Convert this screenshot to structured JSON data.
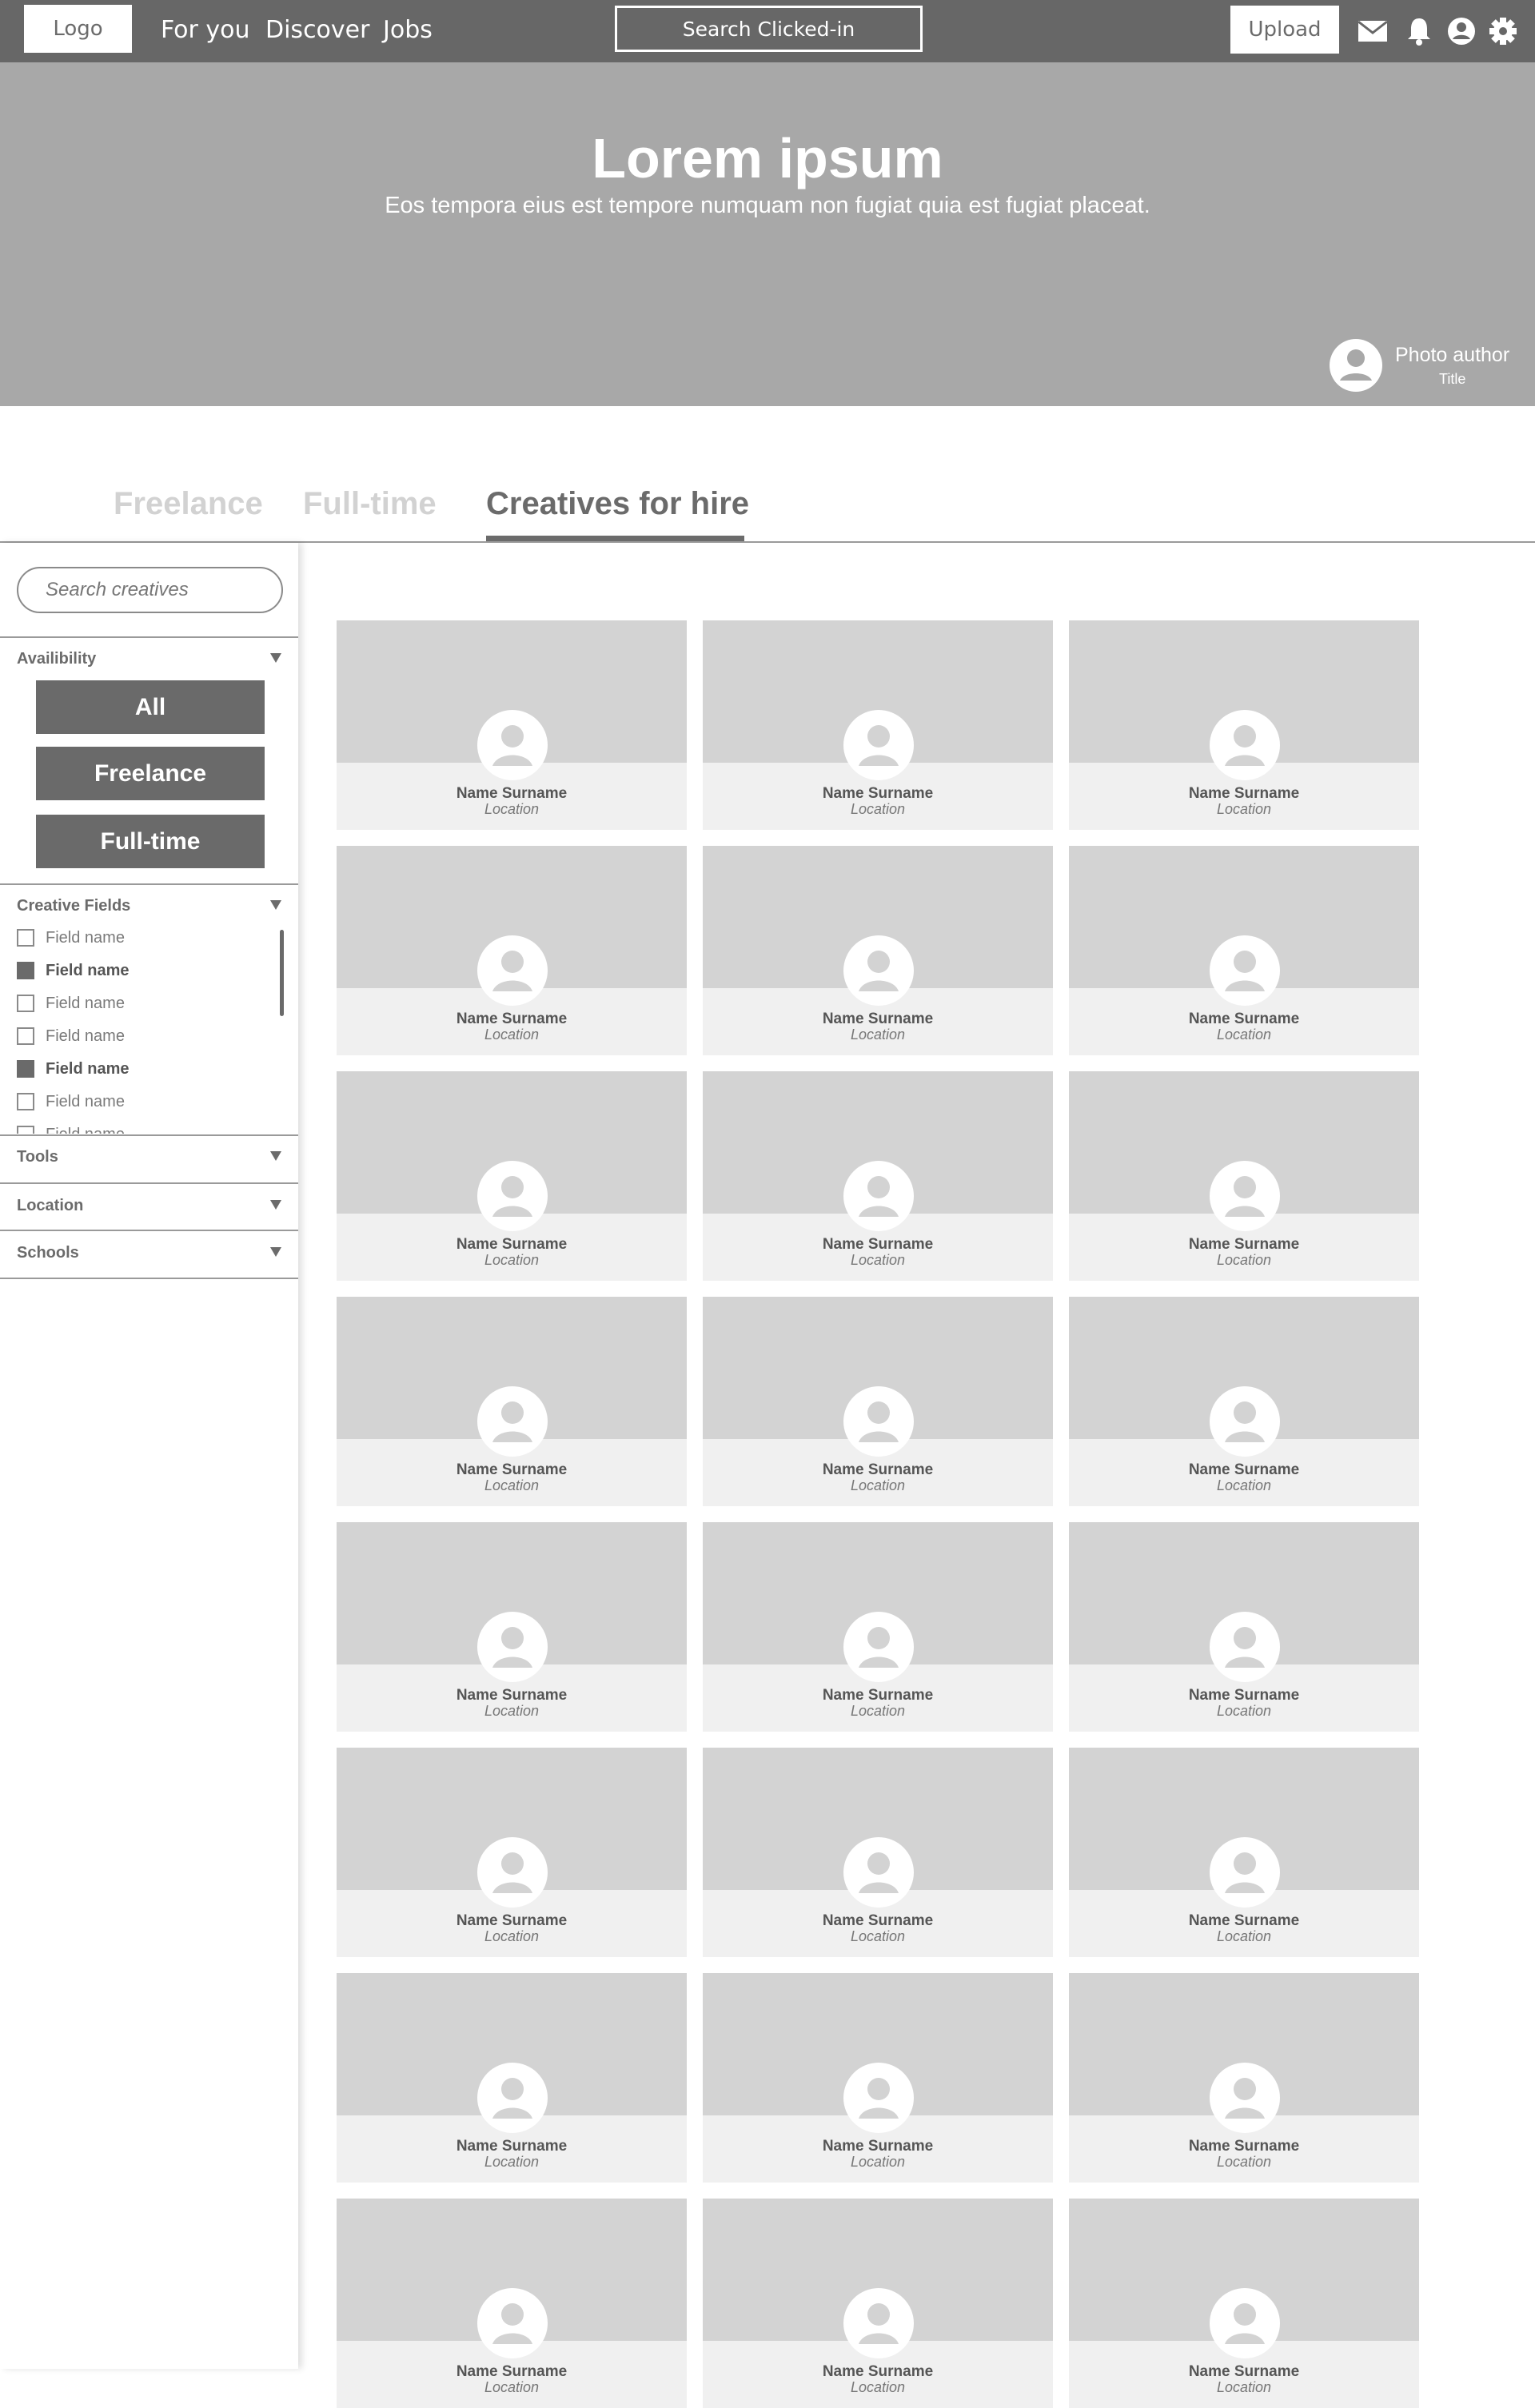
{
  "header": {
    "logo": "Logo",
    "nav": [
      "For you",
      "Discover",
      "Jobs"
    ],
    "search_label": "Search Clicked-in",
    "upload_label": "Upload",
    "icons": [
      "mail-icon",
      "bell-icon",
      "user-icon",
      "gear-icon"
    ]
  },
  "hero": {
    "title": "Lorem ipsum",
    "subtitle": "Eos tempora eius est tempore numquam non fugiat quia est fugiat placeat.",
    "author_name": "Photo author",
    "author_title": "Title"
  },
  "tabs": [
    {
      "label": "Freelance",
      "active": false
    },
    {
      "label": "Full-time",
      "active": false
    },
    {
      "label": "Creatives for hire",
      "active": true
    }
  ],
  "sidebar": {
    "search_placeholder": "Search creatives",
    "availability": {
      "heading": "Availibility",
      "buttons": [
        "All",
        "Freelance",
        "Full-time"
      ]
    },
    "creative_fields": {
      "heading": "Creative Fields",
      "items": [
        {
          "label": "Field name",
          "checked": false
        },
        {
          "label": "Field name",
          "checked": true
        },
        {
          "label": "Field name",
          "checked": false
        },
        {
          "label": "Field name",
          "checked": false
        },
        {
          "label": "Field name",
          "checked": true
        },
        {
          "label": "Field name",
          "checked": false
        },
        {
          "label": "Field name",
          "checked": false
        }
      ]
    },
    "filters": [
      "Tools",
      "Location",
      "Schools"
    ]
  },
  "card_template": {
    "name": "Name Surname",
    "location": "Location"
  },
  "grid": {
    "rows": 8,
    "cols": 3
  },
  "colors": {
    "nav_bg": "#676767",
    "hero_bg": "#a8a8a8",
    "card_image": "#d3d3d3",
    "card_footer": "#f0f0f0",
    "button": "#6a6a6a"
  }
}
